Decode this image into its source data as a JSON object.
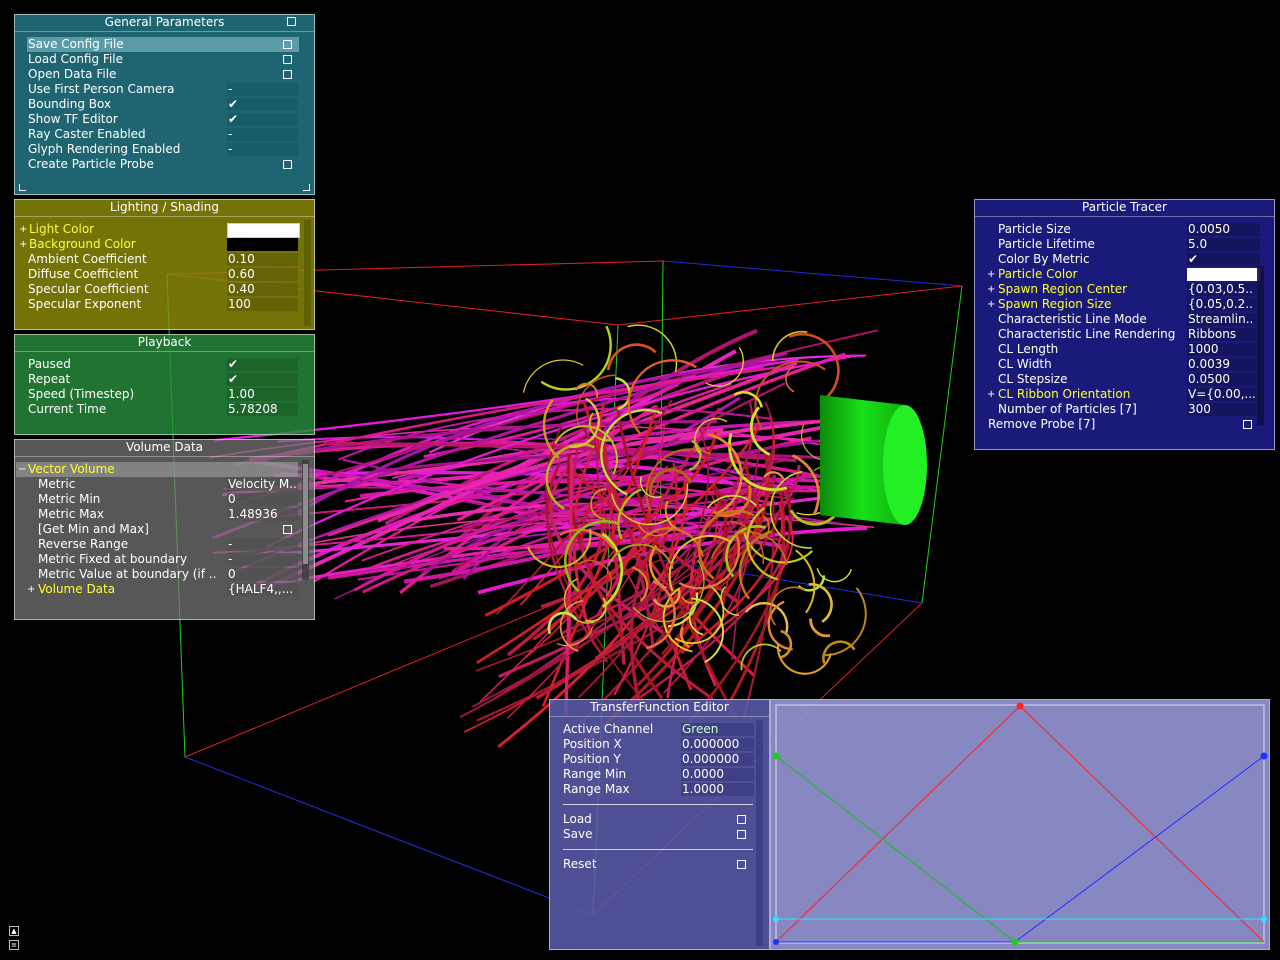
{
  "general": {
    "title": "General Parameters",
    "items": [
      {
        "label": "Save Config File",
        "type": "button"
      },
      {
        "label": "Load Config File",
        "type": "button"
      },
      {
        "label": "Open Data File",
        "type": "button"
      },
      {
        "label": "Use First Person Camera",
        "value": "-"
      },
      {
        "label": "Bounding Box",
        "checked": true
      },
      {
        "label": "Show TF Editor",
        "checked": true
      },
      {
        "label": "Ray Caster Enabled",
        "value": "-"
      },
      {
        "label": "Glyph Rendering Enabled",
        "value": "-"
      },
      {
        "label": "Create Particle Probe",
        "type": "button"
      }
    ]
  },
  "lighting": {
    "title": "Lighting / Shading",
    "light_color_label": "Light Color",
    "light_color": "#ffffff",
    "background_color_label": "Background Color",
    "background_color": "#000000",
    "ambient_label": "Ambient Coefficient",
    "ambient": "0.10",
    "diffuse_label": "Diffuse Coefficient",
    "diffuse": "0.60",
    "specular_label": "Specular Coefficient",
    "specular": "0.40",
    "exponent_label": "Specular Exponent",
    "exponent": "100"
  },
  "playback": {
    "title": "Playback",
    "paused_label": "Paused",
    "repeat_label": "Repeat",
    "speed_label": "Speed (Timestep)",
    "speed": "1.00",
    "time_label": "Current Time",
    "time": "5.78208"
  },
  "volume": {
    "title": "Volume Data",
    "group_label": "Vector Volume",
    "metric_label": "Metric",
    "metric": "Velocity M..",
    "min_label": "Metric Min",
    "min": "0",
    "max_label": "Metric Max",
    "max": "1.48936",
    "getminmax_label": "[Get Min and Max]",
    "reverse_label": "Reverse Range",
    "reverse": "-",
    "fixed_label": "Metric Fixed at boundary",
    "fixed": "-",
    "boundary_label": "Metric Value at boundary (if ..",
    "boundary": "0",
    "data_label": "Volume Data",
    "data": "{HALF4,,..."
  },
  "tracer": {
    "title": "Particle Tracer",
    "size_label": "Particle Size",
    "size": "0.0050",
    "lifetime_label": "Particle Lifetime",
    "lifetime": "5.0",
    "colorby_label": "Color By Metric",
    "pcolor_label": "Particle Color",
    "pcolor": "#ffffff",
    "center_label": "Spawn Region Center",
    "center": "{0.03,0.5..",
    "rsize_label": "Spawn Region Size",
    "rsize": "{0.05,0.2..",
    "mode_label": "Characteristic Line Mode",
    "mode": "Streamlin..",
    "render_label": "Characteristic Line Rendering",
    "render": "Ribbons",
    "cllen_label": "CL Length",
    "cllen": "1000",
    "clwidth_label": "CL Width",
    "clwidth": "0.0039",
    "clstep_label": "CL Stepsize",
    "clstep": "0.0500",
    "orient_label": "CL Ribbon Orientation",
    "orient": "V={0.00,...",
    "count_label": "Number of Particles [7]",
    "count": "300",
    "remove_label": "Remove Probe [7]"
  },
  "tf": {
    "title": "TransferFunction Editor",
    "channel_label": "Active Channel",
    "channel": "Green",
    "posx_label": "Position X",
    "posx": "0.000000",
    "posy_label": "Position Y",
    "posy": "0.000000",
    "rmin_label": "Range Min",
    "rmin": "0.0000",
    "rmax_label": "Range Max",
    "rmax": "1.0000",
    "load_label": "Load",
    "save_label": "Save",
    "reset_label": "Reset"
  },
  "colors": {
    "accent_yellow": "#ffff30",
    "tf_red": "#ff2020",
    "tf_green": "#20d020",
    "tf_blue": "#2030ff",
    "tf_alpha": "#30e0ff"
  }
}
